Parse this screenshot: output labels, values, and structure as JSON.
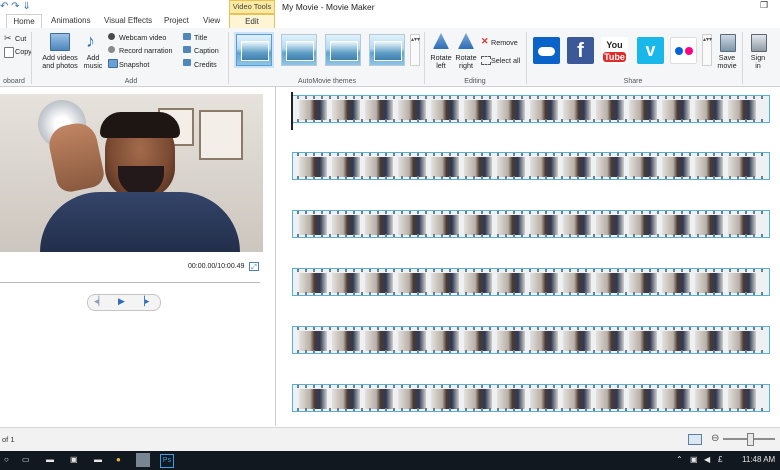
{
  "titlebar": {
    "context_tab": "Video Tools",
    "title": "My Movie - Movie Maker"
  },
  "tabs": [
    {
      "label": "Home"
    },
    {
      "label": "Animations"
    },
    {
      "label": "Visual Effects"
    },
    {
      "label": "Project"
    },
    {
      "label": "View"
    },
    {
      "label": "Edit"
    }
  ],
  "clipboard": {
    "cut": "Cut",
    "copy": "Copy",
    "group_label": "oboard"
  },
  "add": {
    "add_videos": "Add videos and photos",
    "add_music": "Add music",
    "webcam": "Webcam video",
    "record": "Record narration",
    "snapshot": "Snapshot",
    "title": "Title",
    "caption": "Caption",
    "credits": "Credits",
    "group_label": "Add"
  },
  "themes": {
    "group_label": "AutoMovie themes"
  },
  "editing": {
    "rotate_left": "Rotate left",
    "rotate_right": "Rotate right",
    "remove": "Remove",
    "select_all": "Select all",
    "group_label": "Editing"
  },
  "share": {
    "group_label": "Share",
    "save_movie": "Save movie",
    "sign_in": "Sign in",
    "youtube": "You Tube",
    "facebook": "f",
    "vimeo": "v"
  },
  "preview": {
    "timecode": "00:00.00/10:00.49"
  },
  "status": {
    "item": "of 1"
  },
  "taskbar": {
    "clock": "11:48 AM"
  },
  "colors": {
    "accent_blue": "#2f6db5",
    "storyboard_border": "#58b0cf",
    "context_tab_bg": "#fbe9a0"
  }
}
